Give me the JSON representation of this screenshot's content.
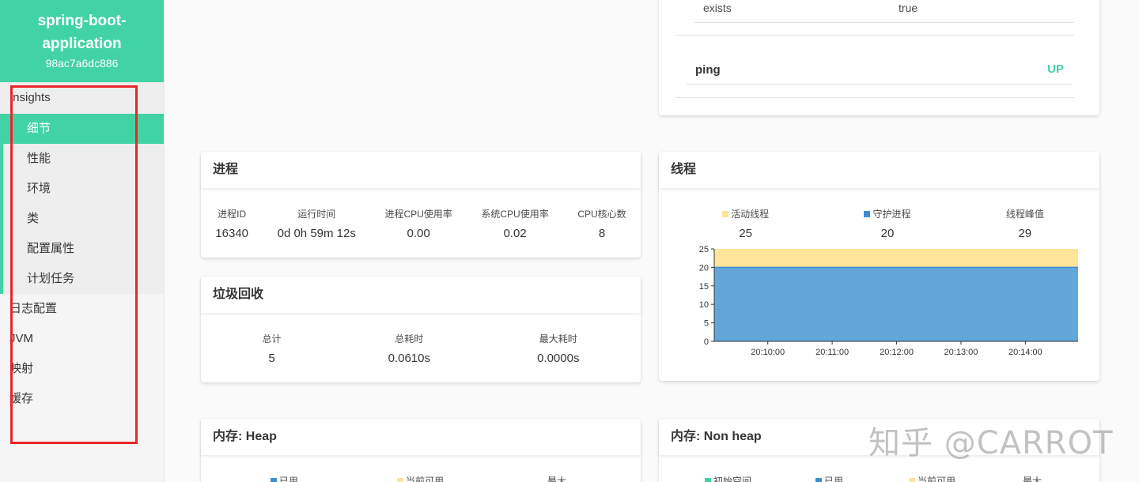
{
  "app": {
    "name_line1": "spring-boot-",
    "name_line2": "application",
    "id": "98ac7a6dc886"
  },
  "sidebar": {
    "group_label": "Insights",
    "group_items": [
      "细节",
      "性能",
      "环境",
      "类",
      "配置属性",
      "计划任务"
    ],
    "items": [
      "日志配置",
      "JVM",
      "映射",
      "缓存"
    ]
  },
  "health": {
    "exists_label": "exists",
    "exists_value": "true",
    "ping_label": "ping",
    "ping_status": "UP"
  },
  "process": {
    "title": "进程",
    "stats": [
      {
        "label": "进程ID",
        "value": "16340"
      },
      {
        "label": "运行时间",
        "value": "0d 0h 59m 12s"
      },
      {
        "label": "进程CPU使用率",
        "value": "0.00"
      },
      {
        "label": "系统CPU使用率",
        "value": "0.02"
      },
      {
        "label": "CPU核心数",
        "value": "8"
      }
    ]
  },
  "gc": {
    "title": "垃圾回收",
    "stats": [
      {
        "label": "总计",
        "value": "5"
      },
      {
        "label": "总耗时",
        "value": "0.0610s"
      },
      {
        "label": "最大耗时",
        "value": "0.0000s"
      }
    ]
  },
  "threads": {
    "title": "线程",
    "stats": [
      {
        "label": "活动线程",
        "value": "25",
        "color": "#ffe59a"
      },
      {
        "label": "守护进程",
        "value": "20",
        "color": "#3e8ed0"
      },
      {
        "label": "线程峰值",
        "value": "29"
      }
    ]
  },
  "memory_heap": {
    "title": "内存: Heap",
    "legend": [
      {
        "label": "已用",
        "color": "#3e8ed0"
      },
      {
        "label": "当前可用",
        "color": "#ffe59a"
      },
      {
        "label": "最大"
      }
    ]
  },
  "memory_nonheap": {
    "title": "内存: Non heap",
    "legend": [
      {
        "label": "初始空间",
        "color": "#42d3a5"
      },
      {
        "label": "已用",
        "color": "#3e8ed0"
      },
      {
        "label": "当前可用",
        "color": "#ffe59a"
      },
      {
        "label": "最大"
      }
    ]
  },
  "chart_data": {
    "type": "area",
    "x": [
      "20:10:00",
      "20:11:00",
      "20:12:00",
      "20:13:00",
      "20:14:00"
    ],
    "y_ticks": [
      0,
      5,
      10,
      15,
      20,
      25
    ],
    "ylim": [
      0,
      25
    ],
    "series": [
      {
        "name": "活动线程",
        "values": [
          25,
          25,
          25,
          25,
          25
        ],
        "color": "#ffe59a"
      },
      {
        "name": "守护进程",
        "values": [
          20,
          20,
          20,
          20,
          20
        ],
        "color": "#63a6da"
      }
    ]
  },
  "watermark": "知乎 @CARROT"
}
